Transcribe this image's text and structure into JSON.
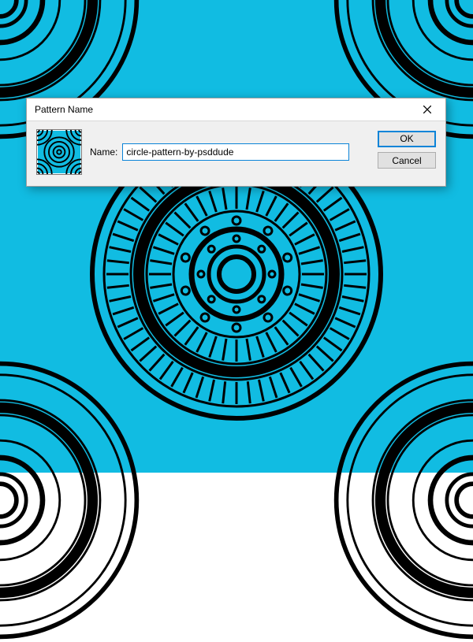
{
  "dialog": {
    "title": "Pattern Name",
    "name_label": "Name:",
    "name_value": "circle-pattern-by-psddude",
    "ok_label": "OK",
    "cancel_label": "Cancel"
  },
  "pattern": {
    "bg_color": "#11bce2",
    "stroke_color": "#000000"
  }
}
